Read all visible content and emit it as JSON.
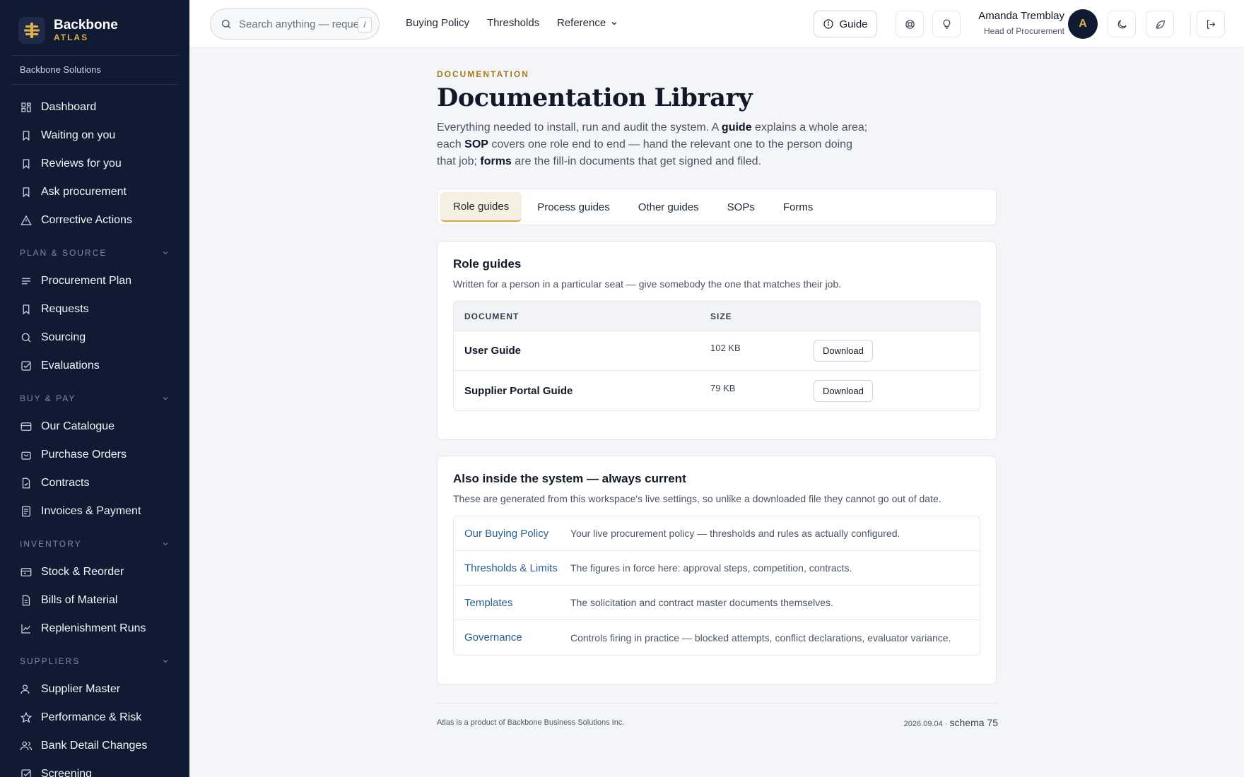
{
  "brand": {
    "name": "Backbone",
    "sub": "ATLAS",
    "org": "Backbone Solutions"
  },
  "sidebar": {
    "top_items": [
      {
        "label": "Dashboard",
        "icon": "dashboard-icon"
      },
      {
        "label": "Waiting on you",
        "icon": "bookmark-icon"
      },
      {
        "label": "Reviews for you",
        "icon": "bookmark-icon"
      },
      {
        "label": "Ask procurement",
        "icon": "bookmark-icon"
      },
      {
        "label": "Corrective Actions",
        "icon": "warning-icon"
      }
    ],
    "sections": [
      {
        "title": "PLAN & SOURCE",
        "items": [
          {
            "label": "Procurement Plan",
            "icon": "list-icon"
          },
          {
            "label": "Requests",
            "icon": "bookmark-icon"
          },
          {
            "label": "Sourcing",
            "icon": "search-icon"
          },
          {
            "label": "Evaluations",
            "icon": "checkbox-icon"
          }
        ]
      },
      {
        "title": "BUY & PAY",
        "items": [
          {
            "label": "Our Catalogue",
            "icon": "catalogue-icon"
          },
          {
            "label": "Purchase Orders",
            "icon": "bag-icon"
          },
          {
            "label": "Contracts",
            "icon": "file-check-icon"
          },
          {
            "label": "Invoices & Payment",
            "icon": "receipt-icon"
          }
        ]
      },
      {
        "title": "INVENTORY",
        "items": [
          {
            "label": "Stock & Reorder",
            "icon": "box-icon"
          },
          {
            "label": "Bills of Material",
            "icon": "file-icon"
          },
          {
            "label": "Replenishment Runs",
            "icon": "chart-icon"
          }
        ]
      },
      {
        "title": "SUPPLIERS",
        "items": [
          {
            "label": "Supplier Master",
            "icon": "user-icon"
          },
          {
            "label": "Performance & Risk",
            "icon": "star-icon"
          },
          {
            "label": "Bank Detail Changes",
            "icon": "users-icon"
          },
          {
            "label": "Screening",
            "icon": "checkbox-icon"
          }
        ]
      }
    ]
  },
  "topbar": {
    "search_placeholder": "Search anything — requests",
    "search_kbd": "/",
    "links": [
      "Buying Policy",
      "Thresholds",
      "Reference"
    ],
    "guide_label": "Guide",
    "user_name": "Amanda Tremblay",
    "user_role": "Head of Procurement",
    "avatar_initial": "A"
  },
  "page": {
    "eyebrow": "DOCUMENTATION",
    "title": "Documentation Library",
    "intro": {
      "p1": "Everything needed to install, run and audit the system. A ",
      "b1": "guide",
      "p2": " explains a whole area; each ",
      "b2": "SOP",
      "p3": " covers one role end to end — hand the relevant one to the person doing that job; ",
      "b3": "forms",
      "p4": " are the fill-in documents that get signed and filed."
    },
    "tabs": [
      "Role guides",
      "Process guides",
      "Other guides",
      "SOPs",
      "Forms"
    ],
    "active_tab": "Role guides"
  },
  "role_guides": {
    "title": "Role guides",
    "description": "Written for a person in a particular seat — give somebody the one that matches their job.",
    "columns": [
      "DOCUMENT",
      "SIZE"
    ],
    "rows": [
      {
        "document": "User Guide",
        "size": "102 KB",
        "action": "Download"
      },
      {
        "document": "Supplier Portal Guide",
        "size": "79 KB",
        "action": "Download"
      }
    ]
  },
  "also_inside": {
    "title": "Also inside the system — always current",
    "description": "These are generated from this workspace's live settings, so unlike a downloaded file they cannot go out of date.",
    "links": [
      {
        "name": "Our Buying Policy",
        "desc": "Your live procurement policy — thresholds and rules as actually configured."
      },
      {
        "name": "Thresholds & Limits",
        "desc": "The figures in force here: approval steps, competition, contracts."
      },
      {
        "name": "Templates",
        "desc": "The solicitation and contract master documents themselves."
      },
      {
        "name": "Governance",
        "desc": "Controls firing in practice — blocked attempts, conflict declarations, evaluator variance."
      }
    ]
  },
  "footer": {
    "left": "Atlas is a product of Backbone Business Solutions Inc.",
    "version": "2026.09.04 ·",
    "schema": "schema 75"
  },
  "colors": {
    "sidebar_bg": "#101a33",
    "accent_gold": "#e0b14a",
    "link_blue": "#2b5f92",
    "tab_active_bg": "#f7f0e0"
  }
}
